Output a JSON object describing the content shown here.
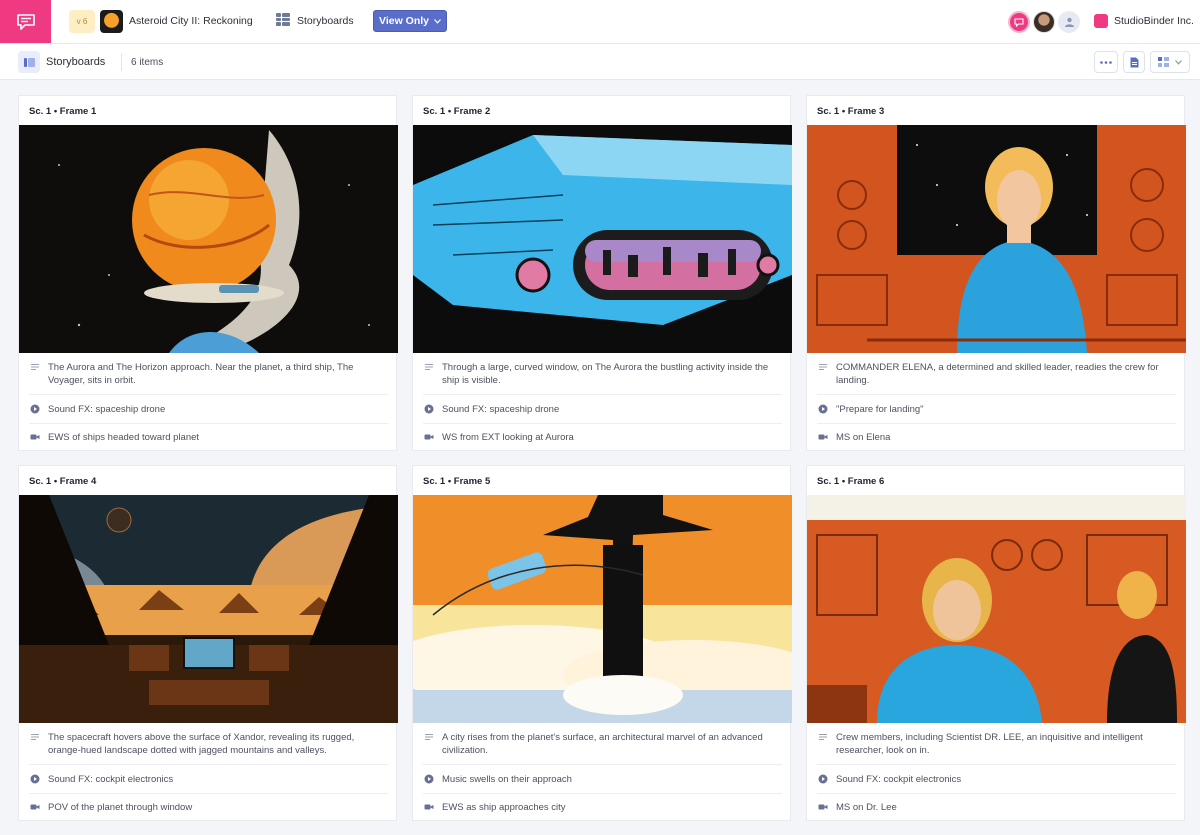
{
  "topbar": {
    "version": "v 6",
    "project_title": "Asteroid City II: Reckoning",
    "section": "Storyboards",
    "view_mode": "View Only",
    "company": "StudioBinder Inc."
  },
  "subbar": {
    "title": "Storyboards",
    "count": "6 items"
  },
  "icons": {
    "logo": "chat-bubble-icon",
    "storyboards": "grid-icon",
    "more": "ellipsis-icon",
    "export": "document-icon",
    "layout": "layout-grid-icon",
    "description": "lines-icon",
    "audio": "play-icon",
    "camera": "camera-icon"
  },
  "colors": {
    "brand": "#ef3a82",
    "accent": "#5a6ec9"
  },
  "frames": [
    {
      "label": "Sc. 1 • Frame 1",
      "description": "The Aurora and The Horizon approach. Near the planet, a third ship, The Voyager, sits in orbit.",
      "audio": "Sound FX: spaceship drone",
      "shot": "EWS of ships headed toward planet"
    },
    {
      "label": "Sc. 1 • Frame 2",
      "description": "Through a large, curved window, on The Aurora the bustling activity inside the ship is visible.",
      "audio": "Sound FX: spaceship drone",
      "shot": "WS from EXT looking at Aurora"
    },
    {
      "label": "Sc. 1 • Frame 3",
      "description": "COMMANDER ELENA, a determined and skilled leader, readies the crew for landing.",
      "audio": "\"Prepare for landing\"",
      "shot": "MS on Elena"
    },
    {
      "label": "Sc. 1 • Frame 4",
      "description": "The spacecraft hovers above the surface of Xandor, revealing its rugged, orange-hued landscape dotted with jagged mountains and valleys.",
      "audio": "Sound FX: cockpit electronics",
      "shot": "POV of the planet through window"
    },
    {
      "label": "Sc. 1 • Frame 5",
      "description": "A city rises from the planet's surface, an architectural marvel of an advanced civilization.",
      "audio": "Music swells on their approach",
      "shot": "EWS as ship approaches city"
    },
    {
      "label": "Sc. 1 • Frame 6",
      "description": "Crew members, including Scientist DR. LEE, an inquisitive and intelligent researcher, look on in.",
      "audio": "Sound FX: cockpit electronics",
      "shot": "MS on Dr. Lee"
    }
  ]
}
